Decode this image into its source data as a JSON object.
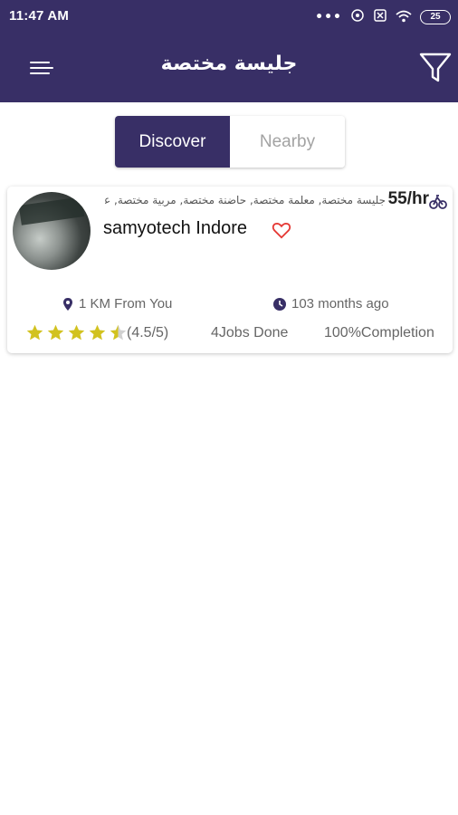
{
  "status_bar": {
    "time": "11:47 AM",
    "battery": "25"
  },
  "app_bar": {
    "title": "جليسة مختصة"
  },
  "tabs": [
    {
      "label": "Discover",
      "active": true
    },
    {
      "label": "Nearby",
      "active": false
    }
  ],
  "providers": [
    {
      "skills": "جليسة مختصة, معلمة مختصة, حاضنة مختصة, مربية مختصة, عنا...",
      "price": "55/hr",
      "name": "samyotech Indore",
      "favorite": false,
      "distance": "1 KM From You",
      "joined": "103 months ago",
      "rating": 4.5,
      "rating_text": "(4.5/5)",
      "jobs_done": "4Jobs Done",
      "completion": "100%Completion"
    }
  ],
  "colors": {
    "primary": "#382f66",
    "star": "#d2c21f",
    "heart": "#e53935"
  }
}
